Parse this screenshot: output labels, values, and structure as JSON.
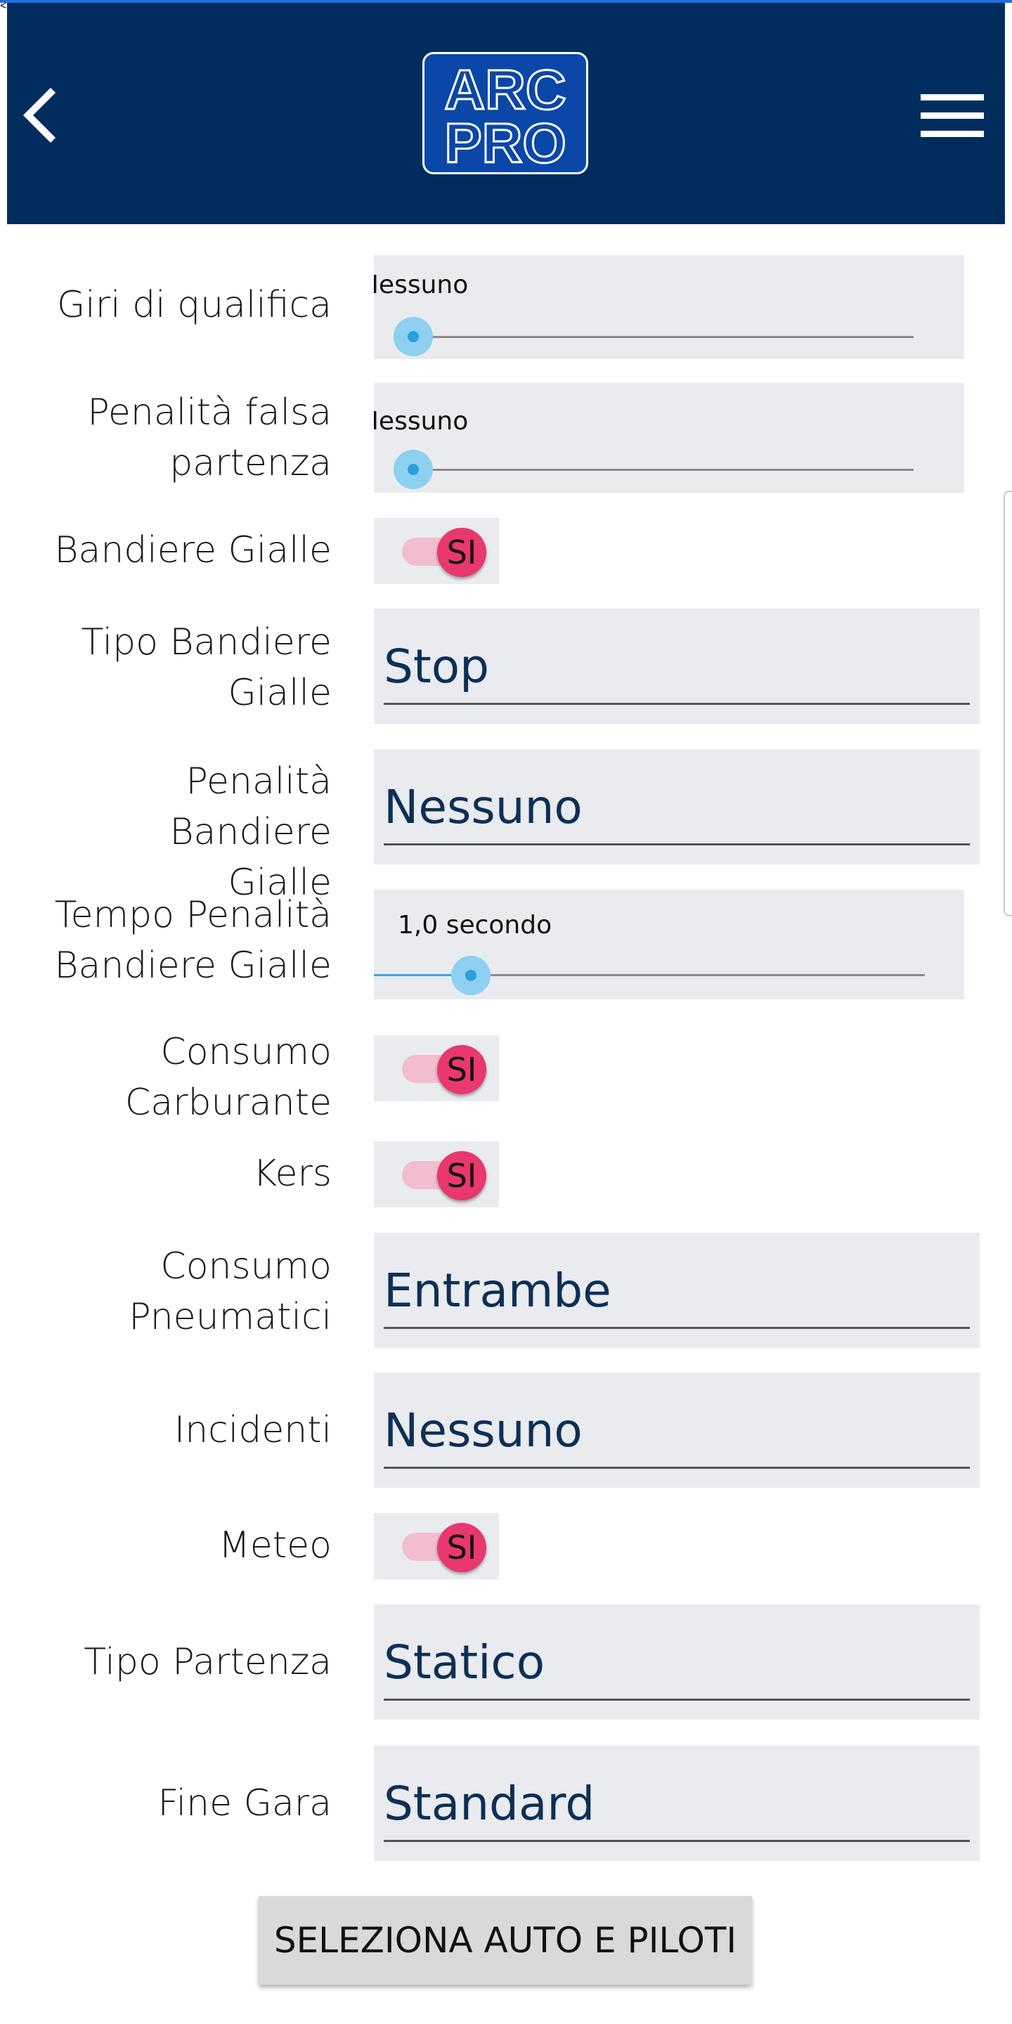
{
  "header": {
    "logo_line1": "ARC",
    "logo_line2": "PRO",
    "back_icon": "chevron-left-icon",
    "menu_icon": "hamburger-menu-icon",
    "background": "#012d5e"
  },
  "settings": {
    "giri_qualifica": {
      "label": "Giri di qualifica",
      "value": "Nessuno",
      "level": 0
    },
    "penalita_falsa": {
      "label_line1": "Penalità falsa",
      "label_line2": "partenza",
      "value": "Nessuno",
      "level": 0
    },
    "bandiere_gialle": {
      "label": "Bandiere Gialle",
      "state": "SI"
    },
    "tipo_bandiere": {
      "label_line1": "Tipo Bandiere",
      "label_line2": "Gialle",
      "value": "Stop"
    },
    "penalita_bandiere": {
      "label_line1": "Penalità Bandiere",
      "label_line2": "Gialle",
      "value": "Nessuno"
    },
    "tempo_penalita": {
      "label_line1": "Tempo Penalità",
      "label_line2": "Bandiere Gialle",
      "value": "1,0 secondo",
      "level": 0.11
    },
    "consumo_carburante": {
      "label_line1": "Consumo",
      "label_line2": "Carburante",
      "state": "SI"
    },
    "kers": {
      "label": "Kers",
      "state": "SI"
    },
    "consumo_pneumatici": {
      "label_line1": "Consumo",
      "label_line2": "Pneumatici",
      "value": "Entrambe"
    },
    "incidenti": {
      "label": "Incidenti",
      "value": "Nessuno"
    },
    "meteo": {
      "label": "Meteo",
      "state": "SI"
    },
    "tipo_partenza": {
      "label": "Tipo Partenza",
      "value": "Statico"
    },
    "fine_gara": {
      "label": "Fine Gara",
      "value": "Standard"
    }
  },
  "actions": {
    "select_cars_label": "SELEZIONA AUTO E PILOTI"
  },
  "colors": {
    "accent": "#0d2f56",
    "toggle_on": "#e8386d",
    "slider": "#2aa0dd"
  }
}
